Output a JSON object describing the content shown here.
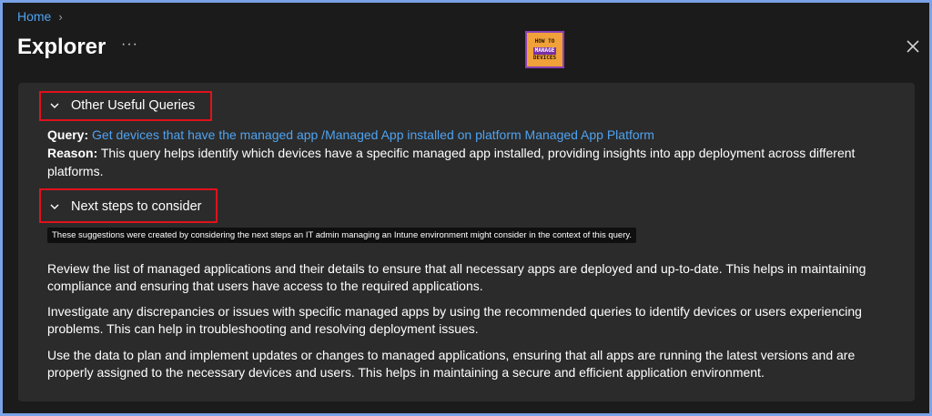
{
  "breadcrumb": {
    "home": "Home"
  },
  "header": {
    "title": "Explorer",
    "more": "···"
  },
  "logo": {
    "line1": "HOW TO",
    "line2": "MANAGE",
    "line3": "DEVICES"
  },
  "sections": {
    "other_queries": {
      "label": "Other Useful Queries"
    },
    "next_steps": {
      "label": "Next steps to consider"
    }
  },
  "query": {
    "query_label": "Query:",
    "query_link": "Get devices that have the managed app /Managed App installed on platform Managed App Platform",
    "reason_label": "Reason:",
    "reason_text_1": "This query helps identify which devices have a specific managed app installed, providing insights into app deployment across different",
    "reason_text_2": "platforms."
  },
  "note": "These suggestions were created by considering the next steps an IT admin managing an Intune environment might consider in the context of this query.",
  "paragraphs": {
    "p1_l1": "Review the list of managed applications and their details to ensure that all necessary apps are deployed and up-to-date. This helps in maintaining",
    "p1_l2": "compliance and ensuring that users have access to the required applications.",
    "p2_l1": "Investigate any discrepancies or issues with specific managed apps by using the recommended queries to identify devices or users experiencing",
    "p2_l2": "problems. This can help in troubleshooting and resolving deployment issues.",
    "p3_l1": "Use the data to plan and implement updates or changes to managed applications, ensuring that all apps are running the latest versions and are",
    "p3_l2": "properly assigned to the necessary devices and users. This helps in maintaining a secure and efficient application environment."
  },
  "colors": {
    "accent": "#4fa3f0",
    "highlight_box": "#e0121d",
    "frame": "#7aa2e6"
  }
}
